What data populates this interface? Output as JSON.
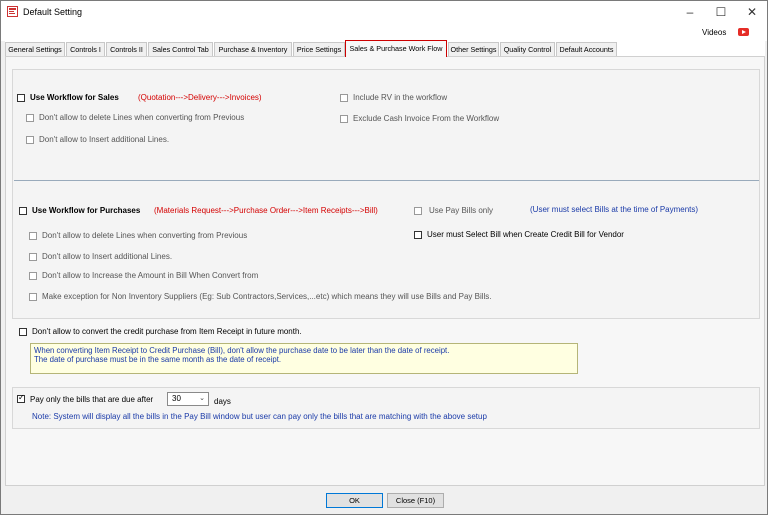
{
  "window": {
    "title": "Default Setting"
  },
  "toolbar": {
    "videos_label": "Videos"
  },
  "tabs": [
    {
      "label": "General Settings"
    },
    {
      "label": "Controls I"
    },
    {
      "label": "Controls II"
    },
    {
      "label": "Sales Control Tab"
    },
    {
      "label": "Purchase & Inventory"
    },
    {
      "label": "Price Settings"
    },
    {
      "label": "Sales & Purchase Work Flow"
    },
    {
      "label": "Other Settings"
    },
    {
      "label": "Quality Control"
    },
    {
      "label": "Default Accounts"
    }
  ],
  "sales": {
    "title": "Use Workflow for Sales",
    "flow": "(Quotation--->Delivery--->Invoices)",
    "opt_delete": "Don't allow to delete Lines when converting from Previous",
    "opt_insert": "Don't allow to Insert additional Lines.",
    "opt_include_rv": "Include RV in the workflow",
    "opt_exclude_cash": "Exclude Cash Invoice From the Workflow"
  },
  "purchases": {
    "title": "Use Workflow for Purchases",
    "flow": "(Materials Request--->Purchase Order--->Item Receipts--->Bill)",
    "opt_pay_bills_only": "Use Pay Bills only",
    "pay_bills_note": "(User must select Bills at the time of Payments)",
    "opt_select_bill": "User must Select Bill when Create Credit Bill for Vendor",
    "opt_delete": "Don't allow to delete Lines when converting from Previous",
    "opt_insert": "Don't allow to Insert additional Lines.",
    "opt_increase": "Don't allow to Increase the Amount in Bill When Convert from",
    "opt_exception": "Make exception for Non Inventory Suppliers (Eg: Sub Contractors,Services,...etc) which means they will use Bills and Pay Bills."
  },
  "credit": {
    "label": "Don't allow to convert the credit purchase from Item Receipt in future month.",
    "note_line1": "When converting Item Receipt to Credit Purchase (Bill), don't allow the purchase date to be later than the date of receipt.",
    "note_line2": "The date of purchase must be in the same month as the date of receipt."
  },
  "paybills": {
    "label": "Pay only the bills that are due after",
    "checked": true,
    "days_value": "30",
    "days_label": "days",
    "note": "Note: System will display all the bills in the Pay Bill window but user can pay only the bills that are matching with the above setup"
  },
  "footer": {
    "ok_label": "OK",
    "close_label": "Close (F10)"
  },
  "icons": {
    "minimize": "minimize-icon",
    "maximize": "maximize-icon",
    "close": "close-icon",
    "youtube": "youtube-icon"
  },
  "colors": {
    "flow_red": "#d40000",
    "note_blue": "#1a3aa8",
    "active_tab_border": "#cc0000",
    "note_bg": "#ffffe1"
  }
}
